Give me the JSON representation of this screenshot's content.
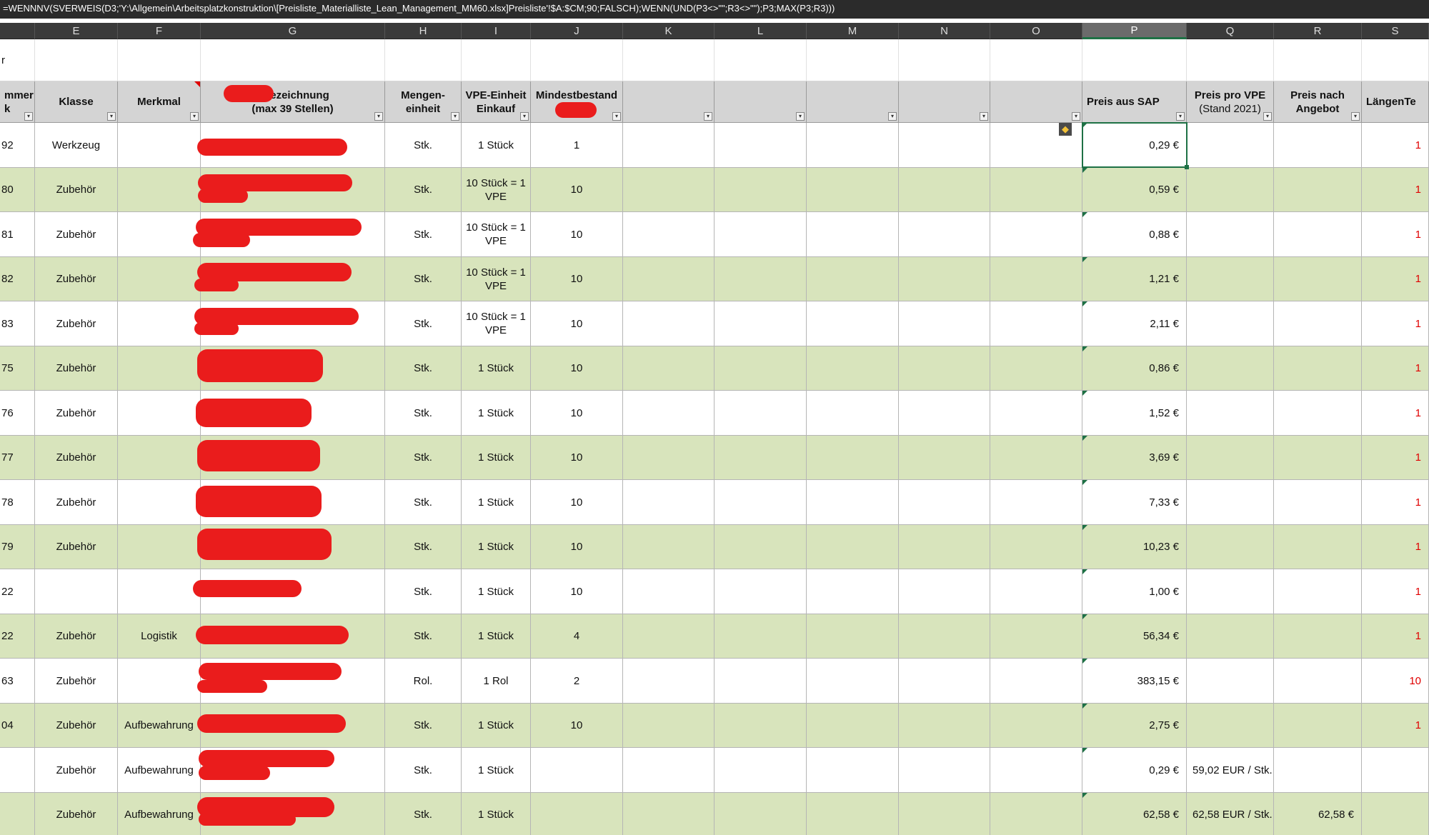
{
  "formula_bar": {
    "text": "=WENNNV(SVERWEIS(D3;'Y:\\Allgemein\\Arbeitsplatzkonstruktion\\[Preisliste_Materialliste_Lean_Management_MM60.xlsx]Preisliste'!$A:$CM;90;FALSCH);WENN(UND(P3<>\"\";R3<>\"\");P3;MAX(P3;R3)))"
  },
  "column_letters": [
    "",
    "E",
    "F",
    "G",
    "H",
    "I",
    "J",
    "K",
    "L",
    "M",
    "N",
    "O",
    "P",
    "Q",
    "R",
    "S"
  ],
  "selected_column": "P",
  "row1": {
    "left_text": "r"
  },
  "headers": {
    "nummer_line1": "mmer",
    "nummer_line2": "k",
    "klasse": "Klasse",
    "merkmal": "Merkmal",
    "bezeichnung_line1": "- Bezeichnung",
    "bezeichnung_line2": "(max 39 Stellen)",
    "mengeneinheit_line1": "Mengen-",
    "mengeneinheit_line2": "einheit",
    "vpe_line1": "VPE-Einheit",
    "vpe_line2": "Einkauf",
    "mindestbestand": "Mindestbestand",
    "preis_sap": "Preis aus SAP",
    "preis_vpe_line1": "Preis pro VPE",
    "preis_vpe_line2": "(Stand 2021)",
    "preis_angebot_line1": "Preis nach",
    "preis_angebot_line2": "Angebot",
    "laengen": "LängenTe"
  },
  "filter_icon": "filter-dropdown-icon",
  "warning_icon": "warning-diamond-icon",
  "colors": {
    "row_green": "#d8e4bc",
    "header_gray": "#d4d4d4",
    "excel_green": "#1e7145",
    "red_text": "#e00000",
    "redaction": "#ea1c1c"
  },
  "rows": [
    {
      "nr": "92",
      "klasse": "Werkzeug",
      "merkmal": "",
      "me": "Stk.",
      "vpe": "1 Stück",
      "min": "1",
      "preis": "0,29 €",
      "vpe_preis": "",
      "angebot": "",
      "laengen": "1"
    },
    {
      "nr": "80",
      "klasse": "Zubehör",
      "merkmal": "",
      "me": "Stk.",
      "vpe": "10 Stück = 1 VPE",
      "min": "10",
      "preis": "0,59 €",
      "vpe_preis": "",
      "angebot": "",
      "laengen": "1"
    },
    {
      "nr": "81",
      "klasse": "Zubehör",
      "merkmal": "",
      "me": "Stk.",
      "vpe": "10 Stück = 1 VPE",
      "min": "10",
      "preis": "0,88 €",
      "vpe_preis": "",
      "angebot": "",
      "laengen": "1"
    },
    {
      "nr": "82",
      "klasse": "Zubehör",
      "merkmal": "",
      "me": "Stk.",
      "vpe": "10 Stück = 1 VPE",
      "min": "10",
      "preis": "1,21 €",
      "vpe_preis": "",
      "angebot": "",
      "laengen": "1"
    },
    {
      "nr": "83",
      "klasse": "Zubehör",
      "merkmal": "",
      "me": "Stk.",
      "vpe": "10 Stück = 1 VPE",
      "min": "10",
      "preis": "2,11 €",
      "vpe_preis": "",
      "angebot": "",
      "laengen": "1"
    },
    {
      "nr": "75",
      "klasse": "Zubehör",
      "merkmal": "",
      "me": "Stk.",
      "vpe": "1 Stück",
      "min": "10",
      "preis": "0,86 €",
      "vpe_preis": "",
      "angebot": "",
      "laengen": "1"
    },
    {
      "nr": "76",
      "klasse": "Zubehör",
      "merkmal": "",
      "me": "Stk.",
      "vpe": "1 Stück",
      "min": "10",
      "preis": "1,52 €",
      "vpe_preis": "",
      "angebot": "",
      "laengen": "1"
    },
    {
      "nr": "77",
      "klasse": "Zubehör",
      "merkmal": "",
      "me": "Stk.",
      "vpe": "1 Stück",
      "min": "10",
      "preis": "3,69 €",
      "vpe_preis": "",
      "angebot": "",
      "laengen": "1"
    },
    {
      "nr": "78",
      "klasse": "Zubehör",
      "merkmal": "",
      "me": "Stk.",
      "vpe": "1 Stück",
      "min": "10",
      "preis": "7,33 €",
      "vpe_preis": "",
      "angebot": "",
      "laengen": "1"
    },
    {
      "nr": "79",
      "klasse": "Zubehör",
      "merkmal": "",
      "me": "Stk.",
      "vpe": "1 Stück",
      "min": "10",
      "preis": "10,23 €",
      "vpe_preis": "",
      "angebot": "",
      "laengen": "1"
    },
    {
      "nr": "22",
      "klasse": "",
      "merkmal": "",
      "me": "Stk.",
      "vpe": "1 Stück",
      "min": "10",
      "preis": "1,00 €",
      "vpe_preis": "",
      "angebot": "",
      "laengen": "1"
    },
    {
      "nr": "22",
      "klasse": "Zubehör",
      "merkmal": "Logistik",
      "me": "Stk.",
      "vpe": "1 Stück",
      "min": "4",
      "preis": "56,34 €",
      "vpe_preis": "",
      "angebot": "",
      "laengen": "1"
    },
    {
      "nr": "63",
      "klasse": "Zubehör",
      "merkmal": "",
      "me": "Rol.",
      "vpe": "1 Rol",
      "min": "2",
      "preis": "383,15 €",
      "vpe_preis": "",
      "angebot": "",
      "laengen": "10"
    },
    {
      "nr": "04",
      "klasse": "Zubehör",
      "merkmal": "Aufbewahrung",
      "me": "Stk.",
      "vpe": "1 Stück",
      "min": "10",
      "preis": "2,75 €",
      "vpe_preis": "",
      "angebot": "",
      "laengen": "1"
    },
    {
      "nr": "",
      "klasse": "Zubehör",
      "merkmal": "Aufbewahrung",
      "me": "Stk.",
      "vpe": "1 Stück",
      "min": "",
      "preis": "0,29 €",
      "vpe_preis": "59,02 EUR / Stk.",
      "angebot": "",
      "laengen": ""
    },
    {
      "nr": "",
      "klasse": "Zubehör",
      "merkmal": "Aufbewahrung",
      "me": "Stk.",
      "vpe": "1 Stück",
      "min": "",
      "preis": "62,58 €",
      "vpe_preis": "62,58 EUR / Stk.",
      "angebot": "62,58 €",
      "laengen": ""
    }
  ]
}
